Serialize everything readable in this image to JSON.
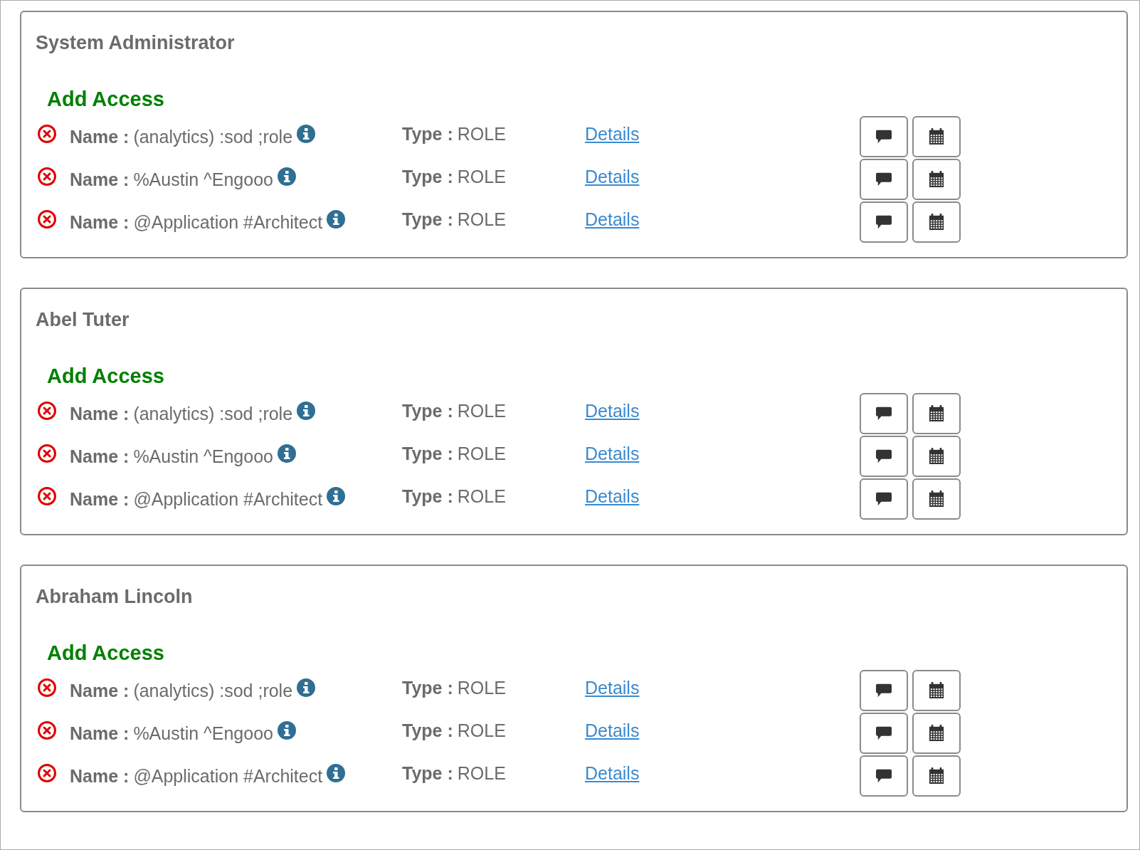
{
  "cards": [
    {
      "title": "System Administrator",
      "add_access": "Add Access",
      "items": [
        {
          "name_label": "Name :",
          "name": "(analytics) :sod ;role",
          "type_label": "Type :",
          "type": "ROLE",
          "link": "Details"
        },
        {
          "name_label": "Name :",
          "name": "%Austin ^Engooo",
          "type_label": "Type :",
          "type": "ROLE",
          "link": "Details"
        },
        {
          "name_label": "Name :",
          "name": "@Application #Architect",
          "type_label": "Type :",
          "type": "ROLE",
          "link": "Details"
        }
      ]
    },
    {
      "title": "Abel Tuter",
      "add_access": "Add Access",
      "items": [
        {
          "name_label": "Name :",
          "name": "(analytics) :sod ;role",
          "type_label": "Type :",
          "type": "ROLE",
          "link": "Details"
        },
        {
          "name_label": "Name :",
          "name": "%Austin ^Engooo",
          "type_label": "Type :",
          "type": "ROLE",
          "link": "Details"
        },
        {
          "name_label": "Name :",
          "name": "@Application #Architect",
          "type_label": "Type :",
          "type": "ROLE",
          "link": "Details"
        }
      ]
    },
    {
      "title": "Abraham Lincoln",
      "add_access": "Add Access",
      "items": [
        {
          "name_label": "Name :",
          "name": "(analytics) :sod ;role",
          "type_label": "Type :",
          "type": "ROLE",
          "link": "Details"
        },
        {
          "name_label": "Name :",
          "name": "%Austin ^Engooo",
          "type_label": "Type :",
          "type": "ROLE",
          "link": "Details"
        },
        {
          "name_label": "Name :",
          "name": "@Application #Architect",
          "type_label": "Type :",
          "type": "ROLE",
          "link": "Details"
        }
      ]
    }
  ]
}
